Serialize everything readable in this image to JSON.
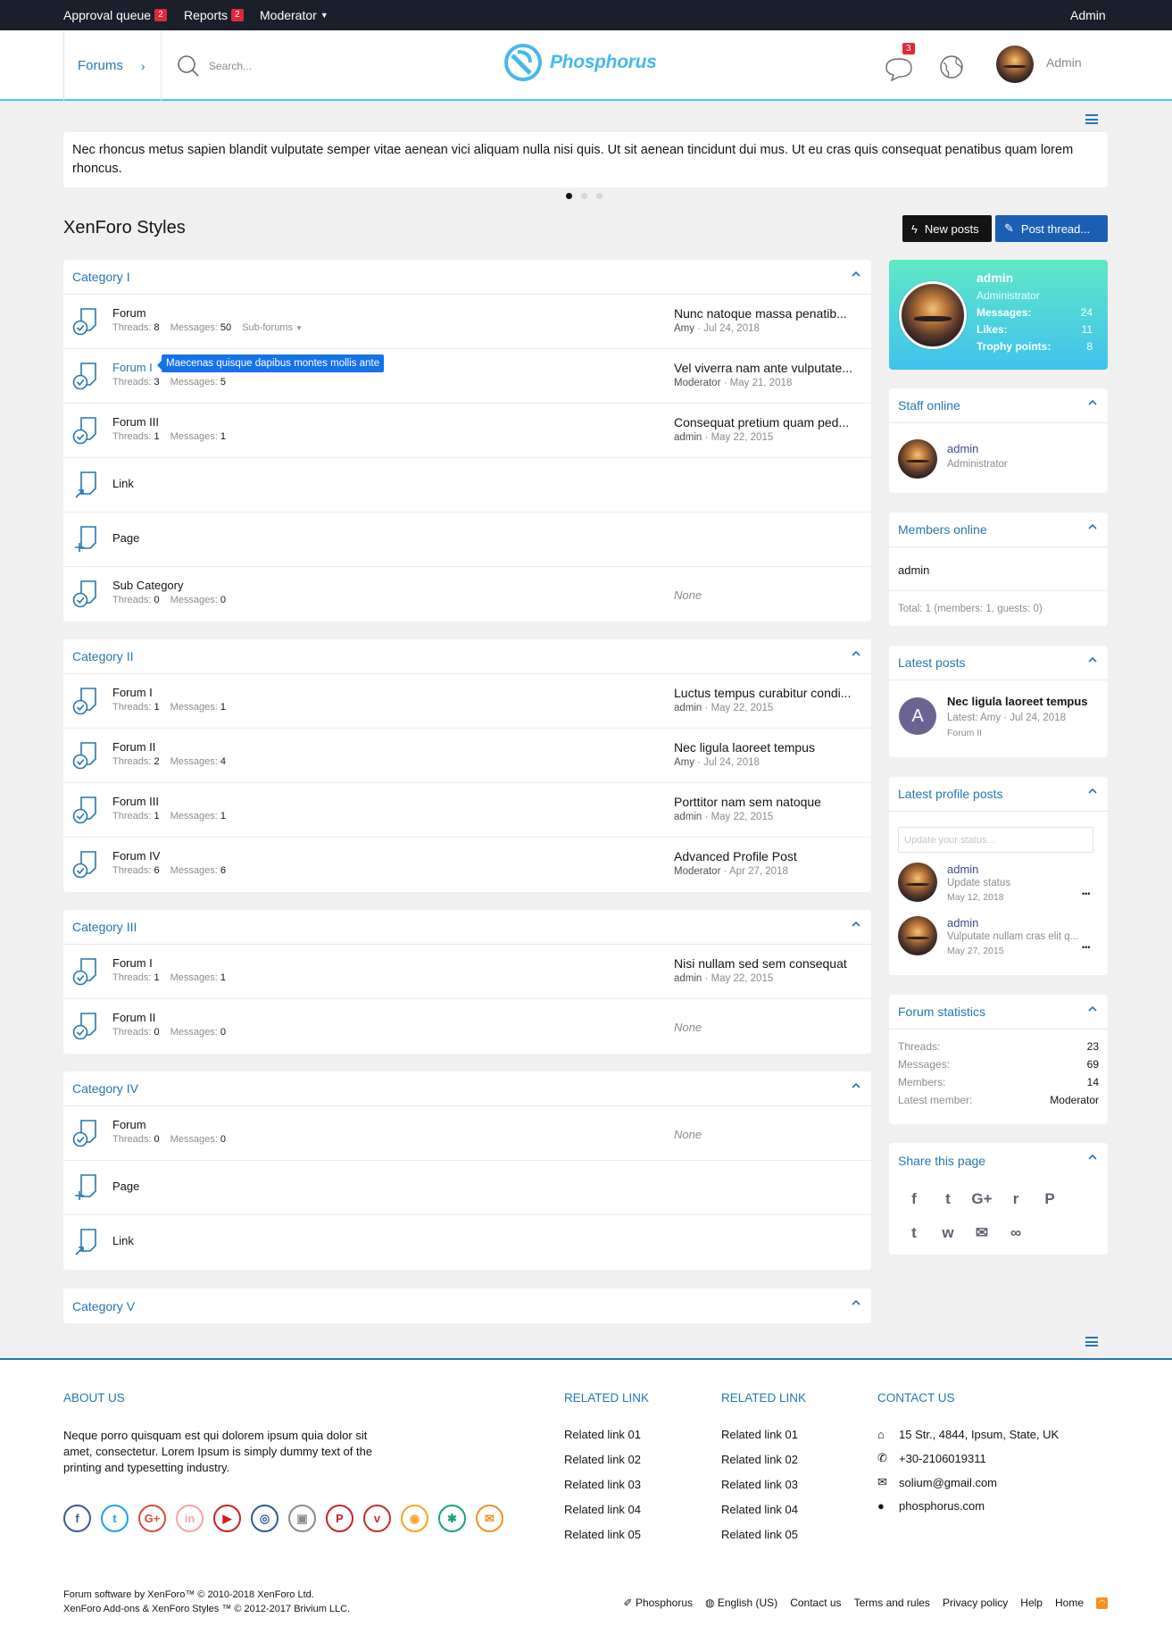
{
  "topbar": {
    "approval_label": "Approval queue",
    "approval_count": "2",
    "reports_label": "Reports",
    "reports_count": "2",
    "moderator_label": "Moderator",
    "user_label": "Admin"
  },
  "header": {
    "breadcrumb": "Forums",
    "search_placeholder": "Search...",
    "logo_text": "Phosphorus",
    "alerts_count": "3",
    "user_name": "Admin"
  },
  "notice": {
    "text": "Nec rhoncus metus sapien blandit vulputate semper vitae aenean vici aliquam nulla nisi quis. Ut sit aenean tincidunt dui mus. Ut eu cras quis consequat penatibus quam lorem rhoncus."
  },
  "page": {
    "title": "XenForo Styles",
    "new_posts": "New posts",
    "post_thread": "Post thread..."
  },
  "tooltip": "Maecenas quisque dapibus montes mollis ante",
  "categories": [
    {
      "title": "Category I",
      "nodes": [
        {
          "type": "forum",
          "title": "Forum",
          "threads": "8",
          "messages": "50",
          "sub": "Sub-forums",
          "last": "Nunc natoque massa penatib...",
          "user": "Amy",
          "date": "Jul 24, 2018"
        },
        {
          "type": "forum",
          "title": "Forum I",
          "threads": "3",
          "messages": "5",
          "last": "Vel viverra nam ante vulputate...",
          "user": "Moderator",
          "date": "May 21, 2018"
        },
        {
          "type": "forum",
          "title": "Forum III",
          "threads": "1",
          "messages": "1",
          "last": "Consequat pretium quam ped...",
          "user": "admin",
          "date": "May 22, 2015"
        },
        {
          "type": "link",
          "title": "Link"
        },
        {
          "type": "page",
          "title": "Page"
        },
        {
          "type": "forum",
          "title": "Sub Category",
          "threads": "0",
          "messages": "0",
          "none": "None"
        }
      ]
    },
    {
      "title": "Category II",
      "nodes": [
        {
          "type": "forum",
          "title": "Forum I",
          "threads": "1",
          "messages": "1",
          "last": "Luctus tempus curabitur condi...",
          "user": "admin",
          "date": "May 22, 2015"
        },
        {
          "type": "forum",
          "title": "Forum II",
          "threads": "2",
          "messages": "4",
          "last": "Nec ligula laoreet tempus",
          "user": "Amy",
          "date": "Jul 24, 2018"
        },
        {
          "type": "forum",
          "title": "Forum III",
          "threads": "1",
          "messages": "1",
          "last": "Porttitor nam sem natoque",
          "user": "admin",
          "date": "May 22, 2015"
        },
        {
          "type": "forum",
          "title": "Forum IV",
          "threads": "6",
          "messages": "6",
          "last": "Advanced Profile Post",
          "user": "Moderator",
          "date": "Apr 27, 2018"
        }
      ]
    },
    {
      "title": "Category III",
      "nodes": [
        {
          "type": "forum",
          "title": "Forum I",
          "threads": "1",
          "messages": "1",
          "last": "Nisi nullam sed sem consequat",
          "user": "admin",
          "date": "May 22, 2015"
        },
        {
          "type": "forum",
          "title": "Forum II",
          "threads": "0",
          "messages": "0",
          "none": "None"
        }
      ]
    },
    {
      "title": "Category IV",
      "nodes": [
        {
          "type": "forum",
          "title": "Forum",
          "threads": "0",
          "messages": "0",
          "none": "None"
        },
        {
          "type": "page",
          "title": "Page"
        },
        {
          "type": "link",
          "title": "Link"
        }
      ]
    },
    {
      "title": "Category V",
      "nodes": []
    }
  ],
  "labels": {
    "threads": "Threads:",
    "messages": "Messages:"
  },
  "visitor": {
    "name": "admin",
    "role": "Administrator",
    "messages_label": "Messages:",
    "messages": "24",
    "likes_label": "Likes:",
    "likes": "11",
    "trophy_label": "Trophy points:",
    "trophy": "8"
  },
  "staff": {
    "title": "Staff online",
    "name": "admin",
    "role": "Administrator"
  },
  "members": {
    "title": "Members online",
    "name": "admin",
    "total": "Total: 1 (members: 1, guests: 0)"
  },
  "latest_posts": {
    "title": "Latest posts",
    "avatar_letter": "A",
    "post_title": "Nec ligula laoreet tempus",
    "meta": "Latest: Amy · Jul 24, 2018",
    "forum": "Forum II"
  },
  "profile_posts": {
    "title": "Latest profile posts",
    "placeholder": "Update your status...",
    "items": [
      {
        "name": "admin",
        "text": "Update status",
        "date": "May 12, 2018",
        "more": "•••"
      },
      {
        "name": "admin",
        "text": "Vulputate nullam cras elit q...",
        "date": "May 27, 2015",
        "more": "•••"
      }
    ]
  },
  "stats": {
    "title": "Forum statistics",
    "rows": [
      {
        "label": "Threads:",
        "value": "23"
      },
      {
        "label": "Messages:",
        "value": "69"
      },
      {
        "label": "Members:",
        "value": "14"
      },
      {
        "label": "Latest member:",
        "value": "Moderator"
      }
    ]
  },
  "share": {
    "title": "Share this page",
    "icons": [
      "f",
      "t",
      "G+",
      "r",
      "P",
      "t",
      "w",
      "✉",
      "∞"
    ]
  },
  "footer": {
    "about_title": "ABOUT US",
    "about_text": "Neque porro quisquam est qui dolorem ipsum quia dolor sit amet, consectetur. Lorem Ipsum is simply dummy text of the printing and typesetting industry.",
    "related1_title": "RELATED LINK",
    "related2_title": "RELATED LINK",
    "links": [
      "Related link 01",
      "Related link 02",
      "Related link 03",
      "Related link 04",
      "Related link 05"
    ],
    "contact_title": "CONTACT US",
    "contact": [
      "15 Str., 4844, Ipsum, State, UK",
      "+30-2106019311",
      "solium@gmail.com",
      "phosphorus.com"
    ],
    "copy1": "Forum software by XenForo™ © 2010-2018 XenForo Ltd.",
    "copy2": "XenForo Add-ons & XenForo Styles ™ © 2012-2017 Brivium LLC.",
    "nav": [
      "Phosphorus",
      "English (US)",
      "Contact us",
      "Terms and rules",
      "Privacy policy",
      "Help",
      "Home"
    ],
    "social": [
      {
        "g": "f",
        "c": "#3b5998"
      },
      {
        "g": "t",
        "c": "#1da1f2"
      },
      {
        "g": "G+",
        "c": "#dd4b39"
      },
      {
        "g": "in",
        "c": "#f0a8a0"
      },
      {
        "g": "▶",
        "c": "#cd201f"
      },
      {
        "g": "◎",
        "c": "#2e5a9c"
      },
      {
        "g": "▣",
        "c": "#8c8c8c"
      },
      {
        "g": "P",
        "c": "#cb2027"
      },
      {
        "g": "v",
        "c": "#c4302b"
      },
      {
        "g": "◉",
        "c": "#f5a623"
      },
      {
        "g": "✱",
        "c": "#1ba672"
      },
      {
        "g": "✉",
        "c": "#f29221"
      }
    ]
  }
}
